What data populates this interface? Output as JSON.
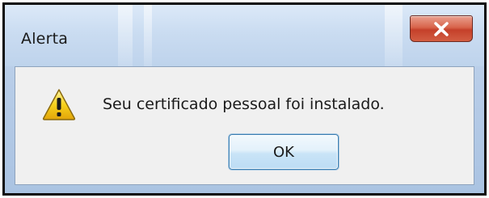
{
  "dialog": {
    "title": "Alerta",
    "message": "Seu certificado pessoal foi instalado.",
    "ok_label": "OK",
    "icon": "warning-icon",
    "close_icon": "close-icon"
  },
  "colors": {
    "titlebar": "#cadcf1",
    "client_background": "#f0f0f0",
    "close_button": "#c4402a",
    "warning_yellow": "#f7d21c"
  }
}
